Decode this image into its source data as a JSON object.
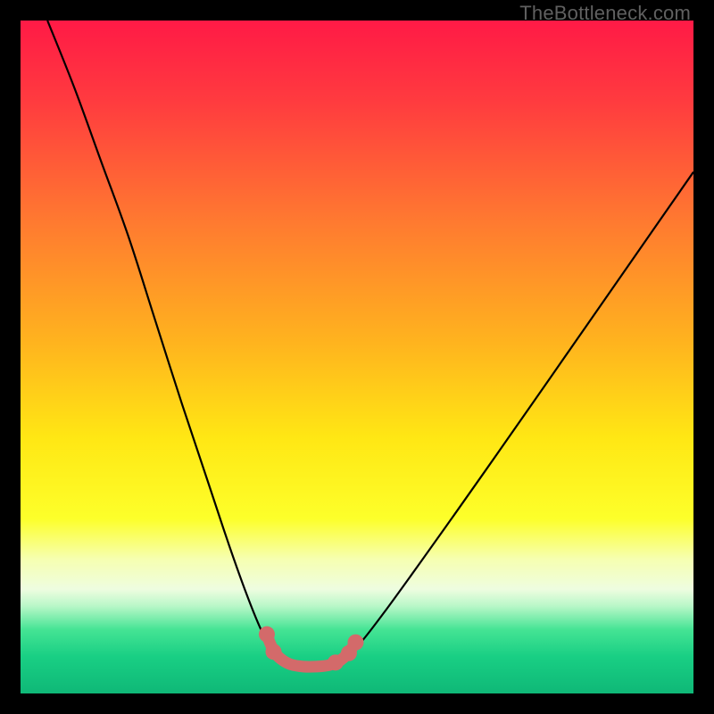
{
  "watermark": "TheBottleneck.com",
  "chart_data": {
    "type": "line",
    "title": "",
    "xlabel": "",
    "ylabel": "",
    "xlim": [
      0,
      100
    ],
    "ylim": [
      0,
      100
    ],
    "gradient_stops": [
      {
        "offset": 0.0,
        "color": "#ff1a46"
      },
      {
        "offset": 0.12,
        "color": "#ff3b3f"
      },
      {
        "offset": 0.3,
        "color": "#ff7a30"
      },
      {
        "offset": 0.48,
        "color": "#ffb41e"
      },
      {
        "offset": 0.62,
        "color": "#ffe714"
      },
      {
        "offset": 0.74,
        "color": "#fdff2a"
      },
      {
        "offset": 0.8,
        "color": "#f6ffb0"
      },
      {
        "offset": 0.845,
        "color": "#eefde0"
      },
      {
        "offset": 0.87,
        "color": "#b9f7c8"
      },
      {
        "offset": 0.905,
        "color": "#45e494"
      },
      {
        "offset": 0.945,
        "color": "#19cf84"
      },
      {
        "offset": 1.0,
        "color": "#0fb877"
      }
    ],
    "series": [
      {
        "name": "bottleneck-curve",
        "stroke": "#000000",
        "points": [
          {
            "x": 4.0,
            "y": 100.0
          },
          {
            "x": 8.0,
            "y": 90.0
          },
          {
            "x": 12.0,
            "y": 79.0
          },
          {
            "x": 16.0,
            "y": 68.0
          },
          {
            "x": 20.0,
            "y": 55.5
          },
          {
            "x": 24.0,
            "y": 43.0
          },
          {
            "x": 28.0,
            "y": 31.0
          },
          {
            "x": 31.0,
            "y": 22.0
          },
          {
            "x": 33.5,
            "y": 15.0
          },
          {
            "x": 35.5,
            "y": 10.0
          },
          {
            "x": 37.0,
            "y": 7.0
          },
          {
            "x": 38.5,
            "y": 5.2
          },
          {
            "x": 40.0,
            "y": 4.4
          },
          {
            "x": 42.0,
            "y": 4.0
          },
          {
            "x": 44.0,
            "y": 4.0
          },
          {
            "x": 46.0,
            "y": 4.2
          },
          {
            "x": 47.5,
            "y": 4.9
          },
          {
            "x": 49.0,
            "y": 6.0
          },
          {
            "x": 51.0,
            "y": 8.1
          },
          {
            "x": 54.0,
            "y": 12.0
          },
          {
            "x": 58.0,
            "y": 17.5
          },
          {
            "x": 63.0,
            "y": 24.5
          },
          {
            "x": 69.0,
            "y": 33.0
          },
          {
            "x": 76.0,
            "y": 43.0
          },
          {
            "x": 84.0,
            "y": 54.5
          },
          {
            "x": 92.0,
            "y": 66.0
          },
          {
            "x": 100.0,
            "y": 77.5
          }
        ]
      },
      {
        "name": "optimal-range-marker",
        "stroke": "#d36a6a",
        "points": [
          {
            "x": 36.5,
            "y": 9.0
          },
          {
            "x": 37.2,
            "y": 7.2
          },
          {
            "x": 38.0,
            "y": 5.8
          },
          {
            "x": 39.0,
            "y": 4.9
          },
          {
            "x": 40.2,
            "y": 4.3
          },
          {
            "x": 42.0,
            "y": 4.0
          },
          {
            "x": 44.0,
            "y": 4.0
          },
          {
            "x": 45.8,
            "y": 4.2
          },
          {
            "x": 47.0,
            "y": 4.6
          },
          {
            "x": 48.0,
            "y": 5.3
          },
          {
            "x": 49.0,
            "y": 6.4
          },
          {
            "x": 49.8,
            "y": 7.6
          }
        ],
        "dots": [
          {
            "x": 36.6,
            "y": 8.8
          },
          {
            "x": 37.6,
            "y": 6.2
          },
          {
            "x": 46.8,
            "y": 4.6
          },
          {
            "x": 48.8,
            "y": 6.0
          },
          {
            "x": 49.8,
            "y": 7.6
          }
        ]
      }
    ]
  }
}
